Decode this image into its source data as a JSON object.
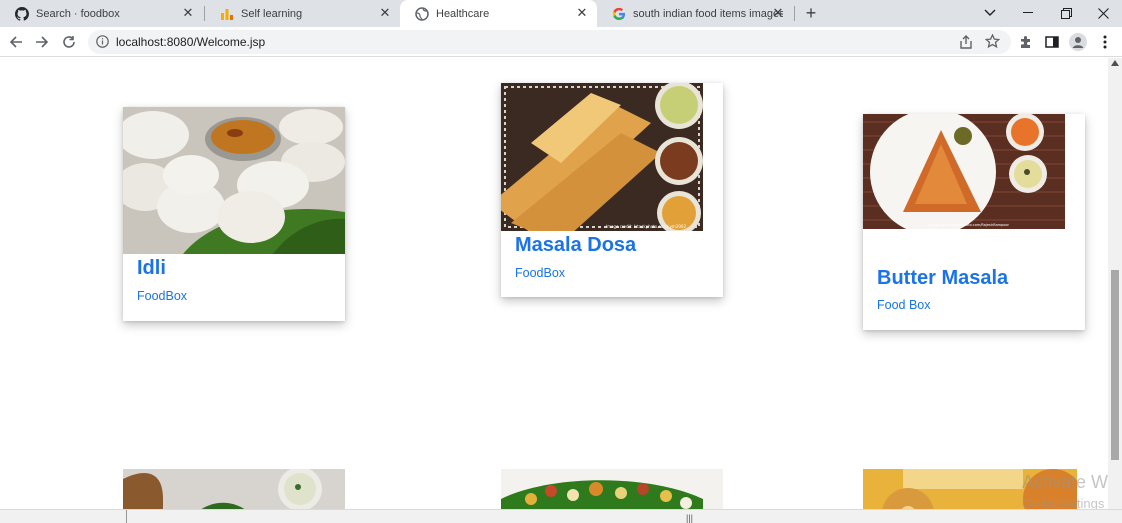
{
  "browser": {
    "tabs": [
      {
        "title": "Search · foodbox",
        "icon": "github-icon",
        "active": false
      },
      {
        "title": "Self learning",
        "icon": "bar-chart-icon",
        "active": false
      },
      {
        "title": "Healthcare",
        "icon": "globe-icon",
        "active": true
      },
      {
        "title": "south indian food items images -",
        "icon": "google-icon",
        "active": false
      }
    ],
    "url": "localhost:8080/Welcome.jsp"
  },
  "cards": [
    {
      "name": "Idli",
      "brand": "FoodBox"
    },
    {
      "name": "Masala Dosa",
      "brand": "FoodBox"
    },
    {
      "name": "Butter Masala",
      "brand": "Food Box"
    }
  ],
  "watermark": {
    "line1": "Activate Wi",
    "line2": "Go to Settings"
  },
  "colors": {
    "accent": "#1a73e8",
    "tabstrip": "#dee1e6"
  }
}
